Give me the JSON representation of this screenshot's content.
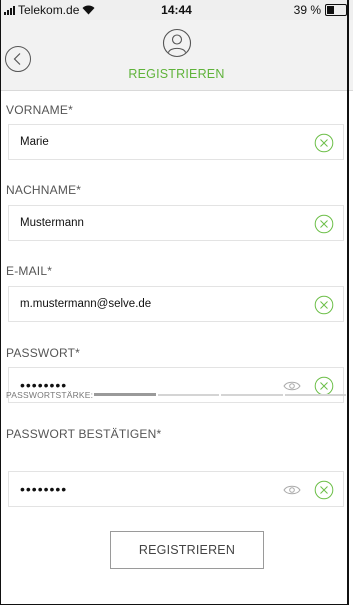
{
  "status_bar": {
    "carrier": "Telekom.de",
    "time": "14:44",
    "battery": "39 %",
    "battery_level": 0.39
  },
  "header": {
    "title": "REGISTRIEREN",
    "back_icon": "chevron-left-circle-icon",
    "avatar_icon": "user-circle-icon"
  },
  "colors": {
    "accent": "#5fb33a",
    "header_bg": "#f2f2f2",
    "border": "#e3e3e3"
  },
  "form": {
    "first_name": {
      "label": "VORNAME*",
      "value": "Marie"
    },
    "last_name": {
      "label": "NACHNAME*",
      "value": "Mustermann"
    },
    "email": {
      "label": "E-MAIL*",
      "value": "m.mustermann@selve.de"
    },
    "password": {
      "label": "PASSWORT*",
      "value": "••••••••"
    },
    "password_strength": {
      "label": "PASSWORTSTÄRKE:",
      "segments": 4,
      "filled": 1
    },
    "password_confirm": {
      "label": "PASSWORT BESTÄTIGEN*",
      "value": "••••••••"
    }
  },
  "submit_label": "REGISTRIEREN"
}
